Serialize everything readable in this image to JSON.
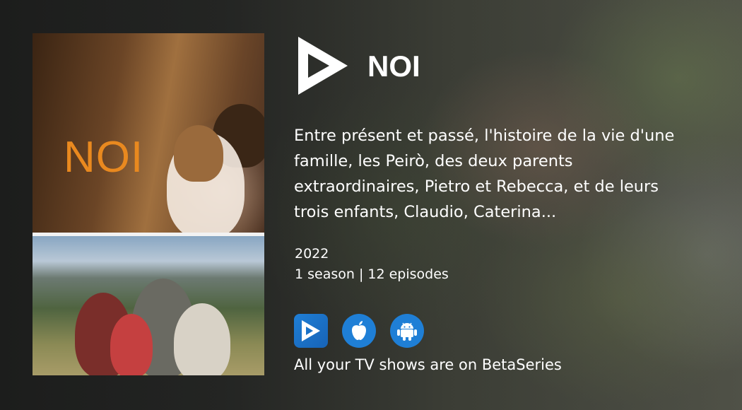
{
  "show": {
    "title": "NOI",
    "poster_title": "NOI",
    "synopsis": "Entre présent et passé, l'histoire de la vie d'une famille, les Peirò, des deux parents extraordinaires, Pietro et Rebecca, et de leurs trois enfants, Claudio, Caterina...",
    "year": "2022",
    "seasons_episodes": "1 season | 12 episodes"
  },
  "apps": [
    {
      "name": "BetaSeries",
      "icon": "betaseries-icon"
    },
    {
      "name": "iOS",
      "icon": "apple-icon"
    },
    {
      "name": "Android",
      "icon": "android-icon"
    }
  ],
  "promo_text": "All your TV shows are on BetaSeries",
  "colors": {
    "accent": "#1f7fd6",
    "poster_title": "#e9891f",
    "text": "#ffffff"
  }
}
